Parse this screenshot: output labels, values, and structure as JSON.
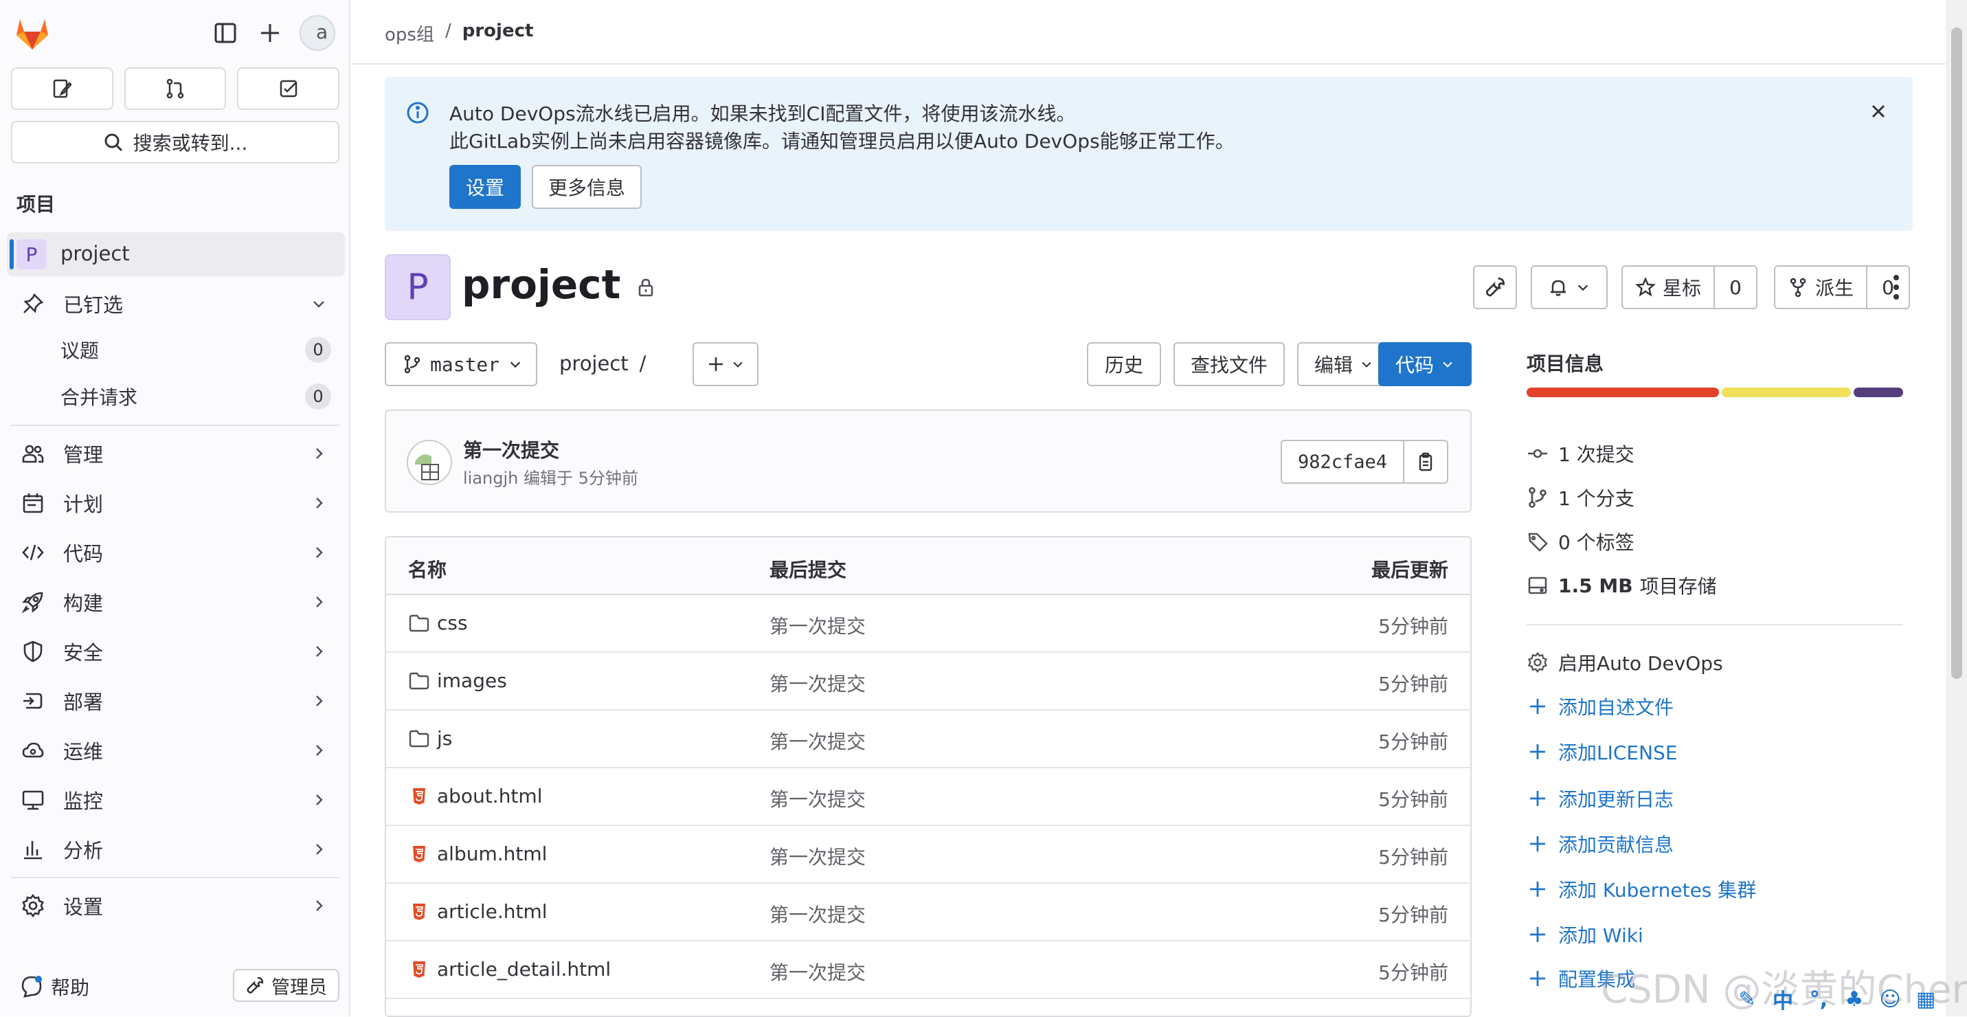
{
  "sidebar": {
    "search_label": "搜索或转到...",
    "section_title": "项目",
    "avatar_text": "a",
    "project_initial": "P",
    "project_name": "project",
    "pinned_label": "已钉选",
    "pinned_items": [
      {
        "label": "议题",
        "count": "0"
      },
      {
        "label": "合并请求",
        "count": "0"
      }
    ],
    "items": [
      {
        "label": "管理",
        "icon": "users-icon"
      },
      {
        "label": "计划",
        "icon": "calendar-icon"
      },
      {
        "label": "代码",
        "icon": "code-icon"
      },
      {
        "label": "构建",
        "icon": "rocket-icon"
      },
      {
        "label": "安全",
        "icon": "shield-icon"
      },
      {
        "label": "部署",
        "icon": "deploy-icon"
      },
      {
        "label": "运维",
        "icon": "cloud-gear-icon"
      },
      {
        "label": "监控",
        "icon": "monitor-icon"
      },
      {
        "label": "分析",
        "icon": "chart-icon"
      },
      {
        "label": "设置",
        "icon": "gear-icon"
      }
    ],
    "help_label": "帮助",
    "admin_label": "管理员"
  },
  "breadcrumb": {
    "group": "ops组",
    "separator": "/",
    "current": "project"
  },
  "alert": {
    "line1": "Auto DevOps流水线已启用。如果未找到CI配置文件，将使用该流水线。",
    "line2": "此GitLab实例上尚未启用容器镜像库。请通知管理员启用以便Auto DevOps能够正常工作。",
    "primary_button": "设置",
    "secondary_button": "更多信息"
  },
  "project": {
    "initial": "P",
    "title": "project",
    "star_label": "星标",
    "star_count": "0",
    "fork_label": "派生",
    "fork_count": "0"
  },
  "repo": {
    "branch": "master",
    "path_root": "project",
    "path_sep": "/",
    "history_label": "历史",
    "find_file_label": "查找文件",
    "edit_label": "编辑",
    "code_label": "代码"
  },
  "commit": {
    "title": "第一次提交",
    "meta": "liangjh 编辑于 5分钟前",
    "sha": "982cfae4"
  },
  "files": {
    "headers": {
      "name": "名称",
      "last_commit": "最后提交",
      "last_update": "最后更新"
    },
    "rows": [
      {
        "name": "css",
        "type": "folder",
        "commit": "第一次提交",
        "time": "5分钟前"
      },
      {
        "name": "images",
        "type": "folder",
        "commit": "第一次提交",
        "time": "5分钟前"
      },
      {
        "name": "js",
        "type": "folder",
        "commit": "第一次提交",
        "time": "5分钟前"
      },
      {
        "name": "about.html",
        "type": "html",
        "commit": "第一次提交",
        "time": "5分钟前"
      },
      {
        "name": "album.html",
        "type": "html",
        "commit": "第一次提交",
        "time": "5分钟前"
      },
      {
        "name": "article.html",
        "type": "html",
        "commit": "第一次提交",
        "time": "5分钟前"
      },
      {
        "name": "article_detail.html",
        "type": "html",
        "commit": "第一次提交",
        "time": "5分钟前"
      }
    ]
  },
  "info": {
    "title": "项目信息",
    "language_colors": [
      "#e24329",
      "#f1e05a",
      "#563d7c"
    ],
    "commits": "1 次提交",
    "branches": "1 个分支",
    "tags": "0 个标签",
    "storage_size": "1.5 MB",
    "storage_label": "项目存储",
    "auto_devops": "启用Auto DevOps",
    "links": [
      "添加自述文件",
      "添加LICENSE",
      "添加更新日志",
      "添加贡献信息",
      "添加 Kubernetes 集群",
      "添加 Wiki",
      "配置集成"
    ]
  },
  "watermark": "CSDN @淡黄的Cherry",
  "tray_text": "中"
}
